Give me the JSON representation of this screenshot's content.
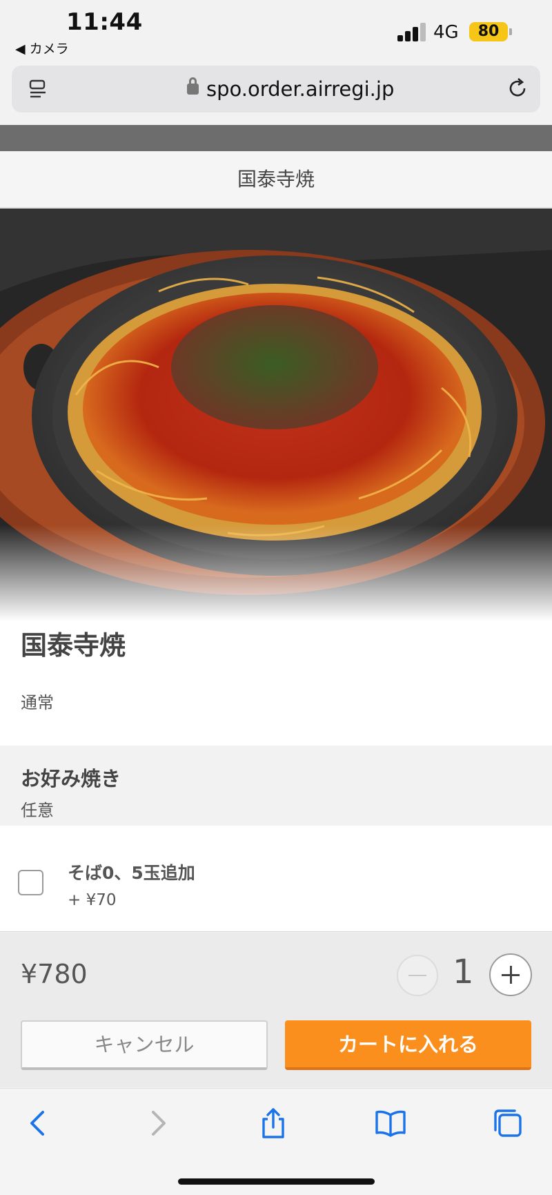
{
  "status": {
    "time": "11:44",
    "back_app": "◀ カメラ",
    "network": "4G",
    "battery": "80"
  },
  "browser": {
    "url": "spo.order.airregi.jp"
  },
  "modal": {
    "header_title": "国泰寺焼",
    "item_title": "国泰寺焼",
    "variant": "通常",
    "option_group": {
      "title": "お好み焼き",
      "requirement": "任意",
      "options": [
        {
          "label": "そば0、5玉追加",
          "price": "+ ¥70",
          "checked": false
        }
      ]
    }
  },
  "order": {
    "price": "¥780",
    "quantity": "1",
    "cancel_label": "キャンセル",
    "add_to_cart_label": "カートに入れる"
  },
  "colors": {
    "accent": "#fb8f1e",
    "battery": "#f5c518",
    "toolbar_icon": "#1a73e8"
  },
  "toolbar": {
    "icons": [
      "back-icon",
      "forward-icon",
      "share-icon",
      "bookmarks-icon",
      "tabs-icon"
    ]
  }
}
